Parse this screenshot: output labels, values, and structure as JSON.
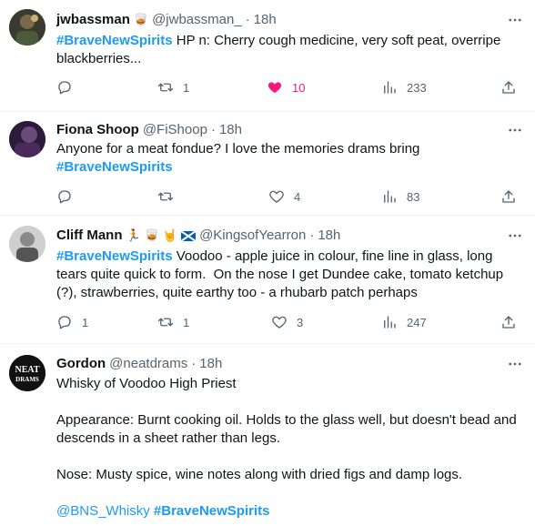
{
  "tweets": [
    {
      "name": "jwbassman",
      "handle": "@jwbassman_",
      "time": "18h",
      "hashtag": "#BraveNewSpirits",
      "text": " HP n: Cherry cough medicine, very soft peat, overripe blackberries...",
      "replies": "",
      "retweets": "1",
      "likes": "10",
      "views": "233"
    },
    {
      "name": "Fiona Shoop",
      "handle": "@FiShoop",
      "time": "18h",
      "text": "Anyone for a meat fondue? I love the memories drams bring",
      "hashtag": "#BraveNewSpirits",
      "replies": "",
      "retweets": "",
      "likes": "4",
      "views": "83"
    },
    {
      "name": "Cliff Mann",
      "handle": "@KingsofYearron",
      "time": "18h",
      "hashtag": "#BraveNewSpirits",
      "text": " Voodoo - apple juice in colour, fine line in glass, long tears quite quick to form.  On the nose I get Dundee cake, tomato ketchup (?), strawberries, quite earthy too - a rhubarb patch perhaps",
      "replies": "1",
      "retweets": "1",
      "likes": "3",
      "views": "247"
    },
    {
      "name": "Gordon",
      "handle": "@neatdrams",
      "time": "18h",
      "avatar_text": "NEAT DRAMS",
      "line1": "Whisky of Voodoo High Priest",
      "line2": "Appearance: Burnt cooking oil. Holds to the glass well, but doesn't bead and descends in a sheet rather than legs.",
      "line3": "Nose: Musty spice, wine notes along with dried figs and damp logs.",
      "mention": "@BNS_Whisky",
      "hashtag": "#BraveNewSpirits"
    }
  ],
  "colors": {
    "accent": "#1d9bf0",
    "like": "#f91880",
    "muted": "#536471"
  },
  "icons": [
    "more-icon",
    "reply-icon",
    "retweet-icon",
    "like-icon",
    "views-icon",
    "share-icon"
  ]
}
